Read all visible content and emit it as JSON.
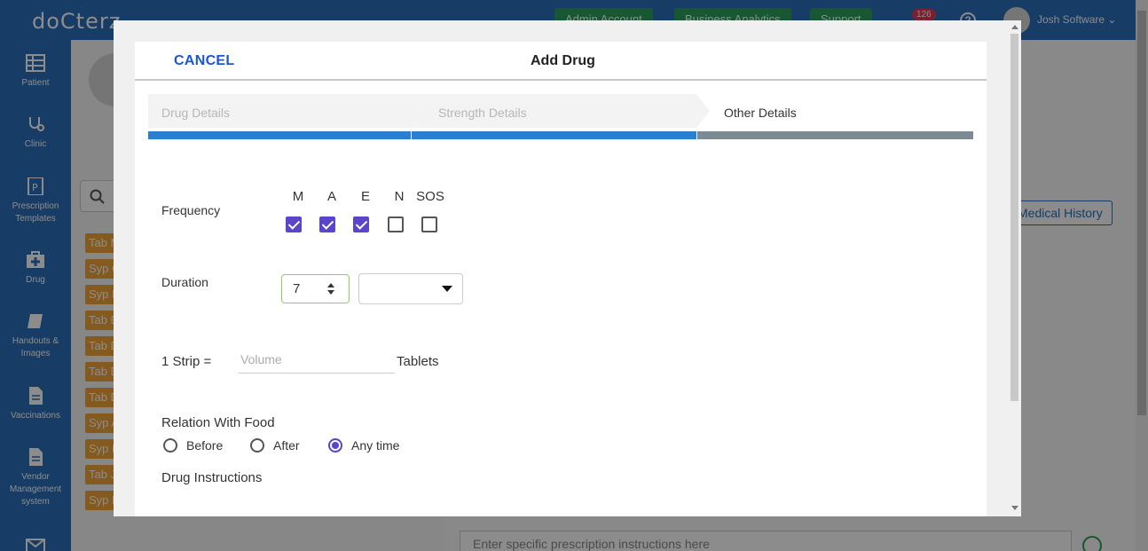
{
  "app": {
    "logo": "doCterz",
    "top_buttons": [
      "Admin Account",
      "Business Analytics",
      "Support"
    ],
    "notification_count": "126",
    "user_name": "Josh Software",
    "sidebar": [
      {
        "label": "Patient",
        "icon": "grid-icon"
      },
      {
        "label": "Clinic",
        "icon": "stethoscope-icon"
      },
      {
        "label": "Prescription Templates",
        "icon": "prescription-icon"
      },
      {
        "label": "Drug",
        "icon": "medical-kit-icon"
      },
      {
        "label": "Handouts & Images",
        "icon": "book-icon"
      },
      {
        "label": "Vaccinations",
        "icon": "document-icon"
      },
      {
        "label": "Vendor Management system",
        "icon": "document-icon"
      },
      {
        "label": "",
        "icon": "mail-icon"
      }
    ],
    "background_tags": [
      "Tab M",
      "Syp C",
      "Syp D",
      "Tab D",
      "Tab D",
      "Tab D",
      "Tab D",
      "Syp A",
      "Syp D",
      "Tab J",
      "Syp D"
    ],
    "medical_history_label": "Medical History",
    "instructions_placeholder": "Enter specific prescription instructions here"
  },
  "modal": {
    "cancel_label": "CANCEL",
    "title": "Add Drug",
    "steps": [
      {
        "label": "Drug Details",
        "state": "done"
      },
      {
        "label": "Strength Details",
        "state": "done"
      },
      {
        "label": "Other Details",
        "state": "active"
      }
    ],
    "frequency": {
      "label": "Frequency",
      "options": [
        {
          "label": "M",
          "checked": true
        },
        {
          "label": "A",
          "checked": true
        },
        {
          "label": "E",
          "checked": true
        },
        {
          "label": "N",
          "checked": false
        },
        {
          "label": "SOS",
          "checked": false
        }
      ]
    },
    "duration": {
      "label": "Duration",
      "value": "7",
      "unit": ""
    },
    "strip": {
      "label": "1 Strip =",
      "volume_placeholder": "Volume",
      "unit": "Tablets"
    },
    "relation_with_food": {
      "label": "Relation With Food",
      "options": [
        {
          "label": "Before",
          "selected": false
        },
        {
          "label": "After",
          "selected": false
        },
        {
          "label": "Any time",
          "selected": true
        }
      ]
    },
    "drug_instructions": {
      "label": "Drug Instructions"
    }
  },
  "colors": {
    "primary": "#2a6ebb",
    "link": "#1a56d6",
    "accent": "#5b45c8",
    "step_done": "#2a7fd0",
    "step_active": "#7b8a93",
    "tag": "#f2a43a",
    "success": "#2e9e5b"
  }
}
